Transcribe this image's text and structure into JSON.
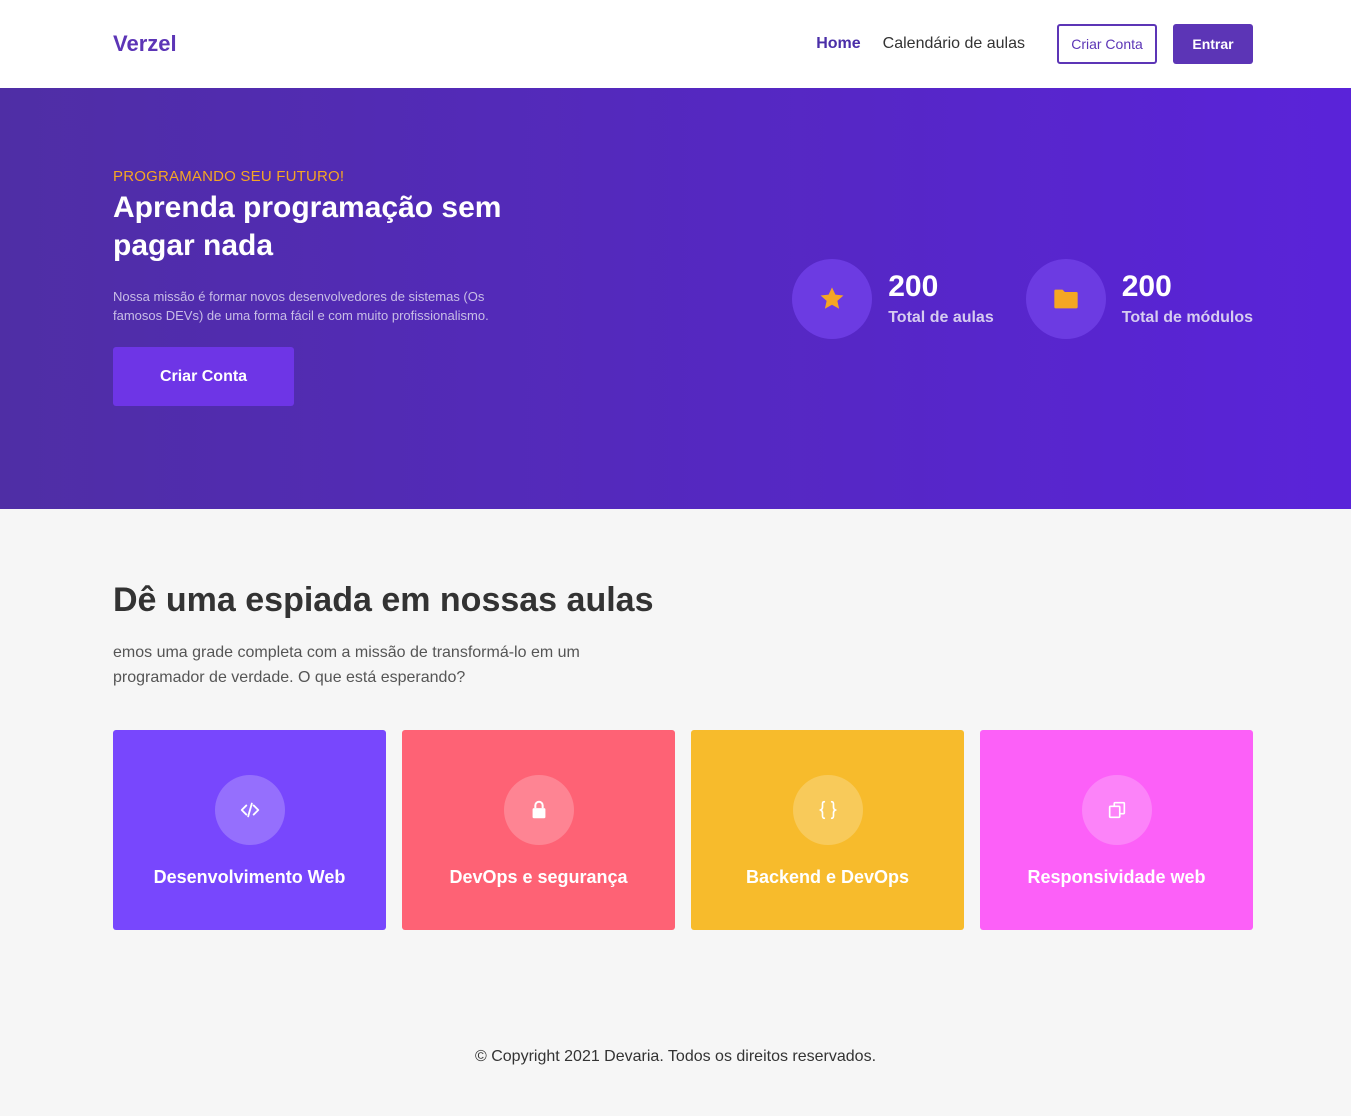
{
  "nav": {
    "logo": "Verzel",
    "links": [
      {
        "label": "Home"
      },
      {
        "label": "Calendário de aulas"
      }
    ],
    "criar_conta": "Criar Conta",
    "entrar": "Entrar"
  },
  "hero": {
    "eyebrow": "PROGRAMANDO SEU FUTURO!",
    "title": "Aprenda programação sem pagar nada",
    "description": "Nossa missão é formar novos desenvolvedores de sistemas (Os famosos DEVs) de uma forma fácil e com muito profissionalismo.",
    "cta": "Criar Conta",
    "stats": [
      {
        "value": "200",
        "label": "Total de aulas",
        "icon": "star-icon"
      },
      {
        "value": "200",
        "label": "Total de módulos",
        "icon": "folder-icon"
      }
    ]
  },
  "courses": {
    "title": "Dê uma espiada em nossas aulas",
    "description": "emos uma grade completa com a missão de transformá-lo em um programador de verdade. O que está esperando?",
    "cards": [
      {
        "title": "Desenvolvimento Web",
        "color": "#7847fd",
        "icon": "code-icon"
      },
      {
        "title": "DevOps e segurança",
        "color": "#fe6275",
        "icon": "lock-icon"
      },
      {
        "title": "Backend e DevOps",
        "color": "#f7bb2c",
        "icon": "braces-icon"
      },
      {
        "title": "Responsividade web",
        "color": "#fc60f8",
        "icon": "copy-icon"
      }
    ]
  },
  "footer": {
    "text": "© Copyright 2021 Devaria. Todos os direitos reservados."
  },
  "colors": {
    "brand": "#5c35b6",
    "accent": "#f5a623"
  }
}
